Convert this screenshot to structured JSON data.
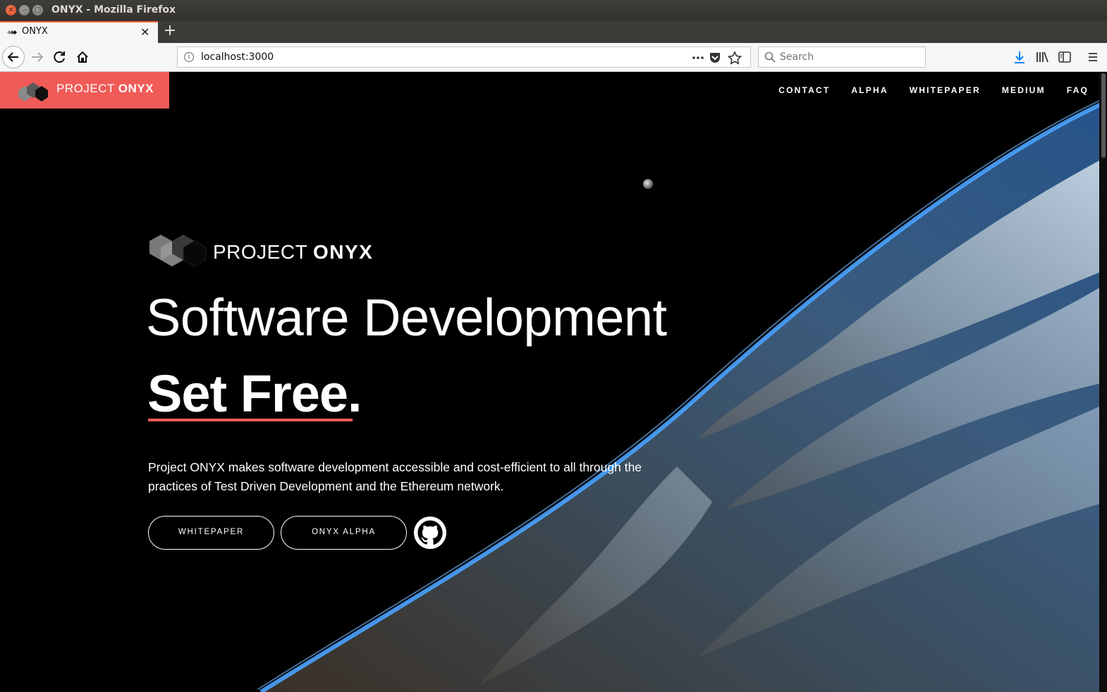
{
  "window": {
    "title": "ONYX - Mozilla Firefox"
  },
  "tab": {
    "title": "ONYX"
  },
  "urlbar": {
    "url": "localhost:3000"
  },
  "searchbar": {
    "placeholder": "Search"
  },
  "site": {
    "brand": {
      "word1": "PROJECT",
      "word2": "ONYX"
    },
    "nav": [
      "CONTACT",
      "ALPHA",
      "WHITEPAPER",
      "MEDIUM",
      "FAQ"
    ],
    "hero": {
      "logo_word1": "PROJECT",
      "logo_word2": "ONYX",
      "headline": "Software Development",
      "tagline": "Set Free",
      "tagline_suffix": ".",
      "intro": "Project ONYX makes software development accessible and cost-efficient to all through the practices of Test Driven Development and the Ethereum network.",
      "buttons": {
        "whitepaper": "WHITEPAPER",
        "alpha": "ONYX ALPHA"
      }
    }
  },
  "colors": {
    "brand": "#f05b57",
    "tab_accent": "#ff6b3d",
    "earth_blue": "#1f4e8c"
  }
}
